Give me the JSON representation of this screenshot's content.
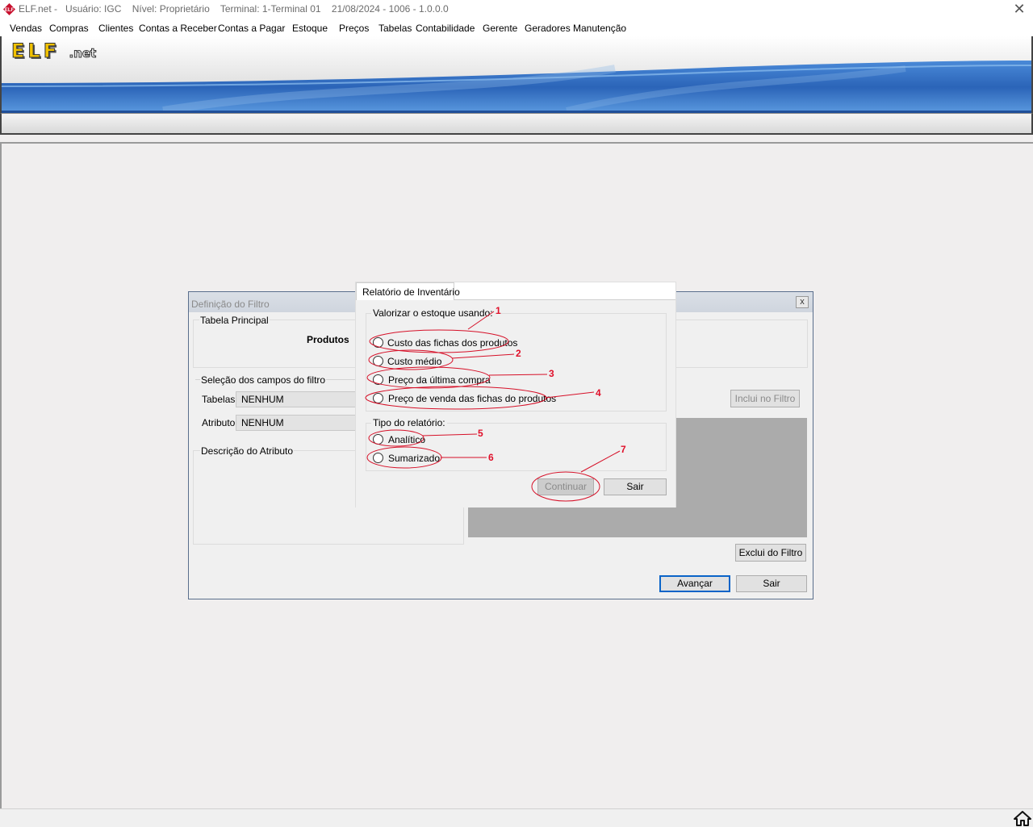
{
  "titlebar": {
    "text": "ELF.net -   Usuário: IGC    Nível: Proprietário    Terminal: 1-Terminal 01    21/08/2024 - 1006 - 1.0.0.0",
    "close": "✕"
  },
  "menu": [
    "Vendas",
    "Compras",
    "Clientes",
    "Contas a Receber",
    "Contas a Pagar",
    "Estoque",
    "Preços",
    "Tabelas",
    "Contabilidade",
    "Gerente",
    "Geradores",
    "Manutenção"
  ],
  "logo": {
    "main": "ELF",
    "suffix": ".net"
  },
  "filter_window": {
    "title": "Definição do Filtro",
    "close": "x",
    "group_principal": "Tabela Principal",
    "principal_value": "Produtos",
    "group_selecao": "Seleção dos campos do filtro",
    "tabelas_label": "Tabelas",
    "tabelas_value": "NENHUM",
    "atributo_label": "Atributo",
    "atributo_value": "NENHUM",
    "group_descricao": "Descrição do Atributo",
    "inclui_button": "Inclui no Filtro",
    "exclui_button": "Exclui do Filtro",
    "avancar_button": "Avançar",
    "sair_button": "Sair"
  },
  "inventory_dialog": {
    "tab": "Relatório de Inventário",
    "group_valorizar": "Valorizar o estoque usando:",
    "options_valorizar": [
      "Custo das fichas dos produtos",
      "Custo médio",
      "Preço da última compra",
      "Preço de venda das fichas do produtos"
    ],
    "group_tipo": "Tipo do relatório:",
    "options_tipo": [
      "Analítico",
      "Sumarizado"
    ],
    "continuar_button": "Continuar",
    "sair_button": "Sair"
  },
  "annotations": [
    "1",
    "2",
    "3",
    "4",
    "5",
    "6",
    "7"
  ],
  "colors": {
    "annotation": "#e0102a",
    "banner_blue": "#2f6fc4",
    "logo_yellow": "#f2c200"
  }
}
